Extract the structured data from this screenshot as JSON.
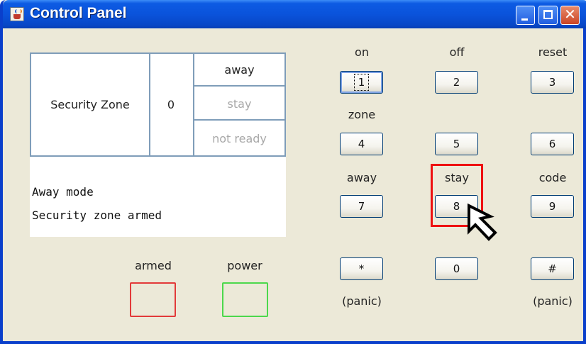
{
  "window": {
    "title": "Control Panel",
    "close_symbol": "✕"
  },
  "status": {
    "zone_label": "Security Zone",
    "zone_count": "0",
    "mode_away": "away",
    "mode_stay": "stay",
    "mode_not_ready": "not ready"
  },
  "display": {
    "line1": "Away mode",
    "line2": "Security zone armed"
  },
  "indicators": {
    "armed": "armed",
    "power": "power"
  },
  "keypad": {
    "labels": {
      "on": "on",
      "off": "off",
      "reset": "reset",
      "zone": "zone",
      "away": "away",
      "stay": "stay",
      "code": "code",
      "panic_left": "(panic)",
      "panic_right": "(panic)"
    },
    "keys": [
      "1",
      "2",
      "3",
      "4",
      "5",
      "6",
      "7",
      "8",
      "9",
      "*",
      "0",
      "#"
    ]
  },
  "colors": {
    "highlight": "#EE1111",
    "armed_border": "#E23A3A",
    "power_border": "#4CD84C",
    "titlebar": "#0A53DB"
  }
}
